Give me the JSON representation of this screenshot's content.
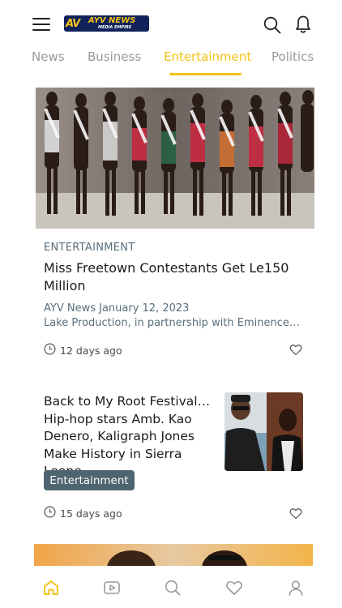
{
  "header": {
    "logo_mark": "AV",
    "logo_main": "AYV NEWS",
    "logo_sub": "MEDIA EMPIRE",
    "icons": [
      "menu-icon",
      "search-icon",
      "bell-icon"
    ]
  },
  "tabs": [
    {
      "label": "News",
      "active": false
    },
    {
      "label": "Business",
      "active": false
    },
    {
      "label": "Entertainment",
      "active": true
    },
    {
      "label": "Politics",
      "active": false
    }
  ],
  "articles": [
    {
      "category": "ENTERTAINMENT",
      "title": "Miss Freetown Contestants Get Le150 Million",
      "byline": "AYV News January 12, 2023",
      "excerpt": "Lake Production, in partnership with Eminence Events and Entertainment",
      "time": "12 days ago"
    },
    {
      "title": "Back to My Root Festival… Hip-hop stars Amb. Kao Denero, Kaligraph Jones Make History in Sierra Leone",
      "tag": "Entertainment",
      "time": "15 days ago"
    }
  ],
  "bottom_nav": {
    "items": [
      "home-icon",
      "video-icon",
      "search-icon",
      "heart-icon",
      "profile-icon"
    ],
    "active": "home-icon"
  },
  "colors": {
    "accent": "#f2c314",
    "brand_navy": "#11225a",
    "muted_text": "#586e7c",
    "chip_bg": "#4e6470"
  }
}
